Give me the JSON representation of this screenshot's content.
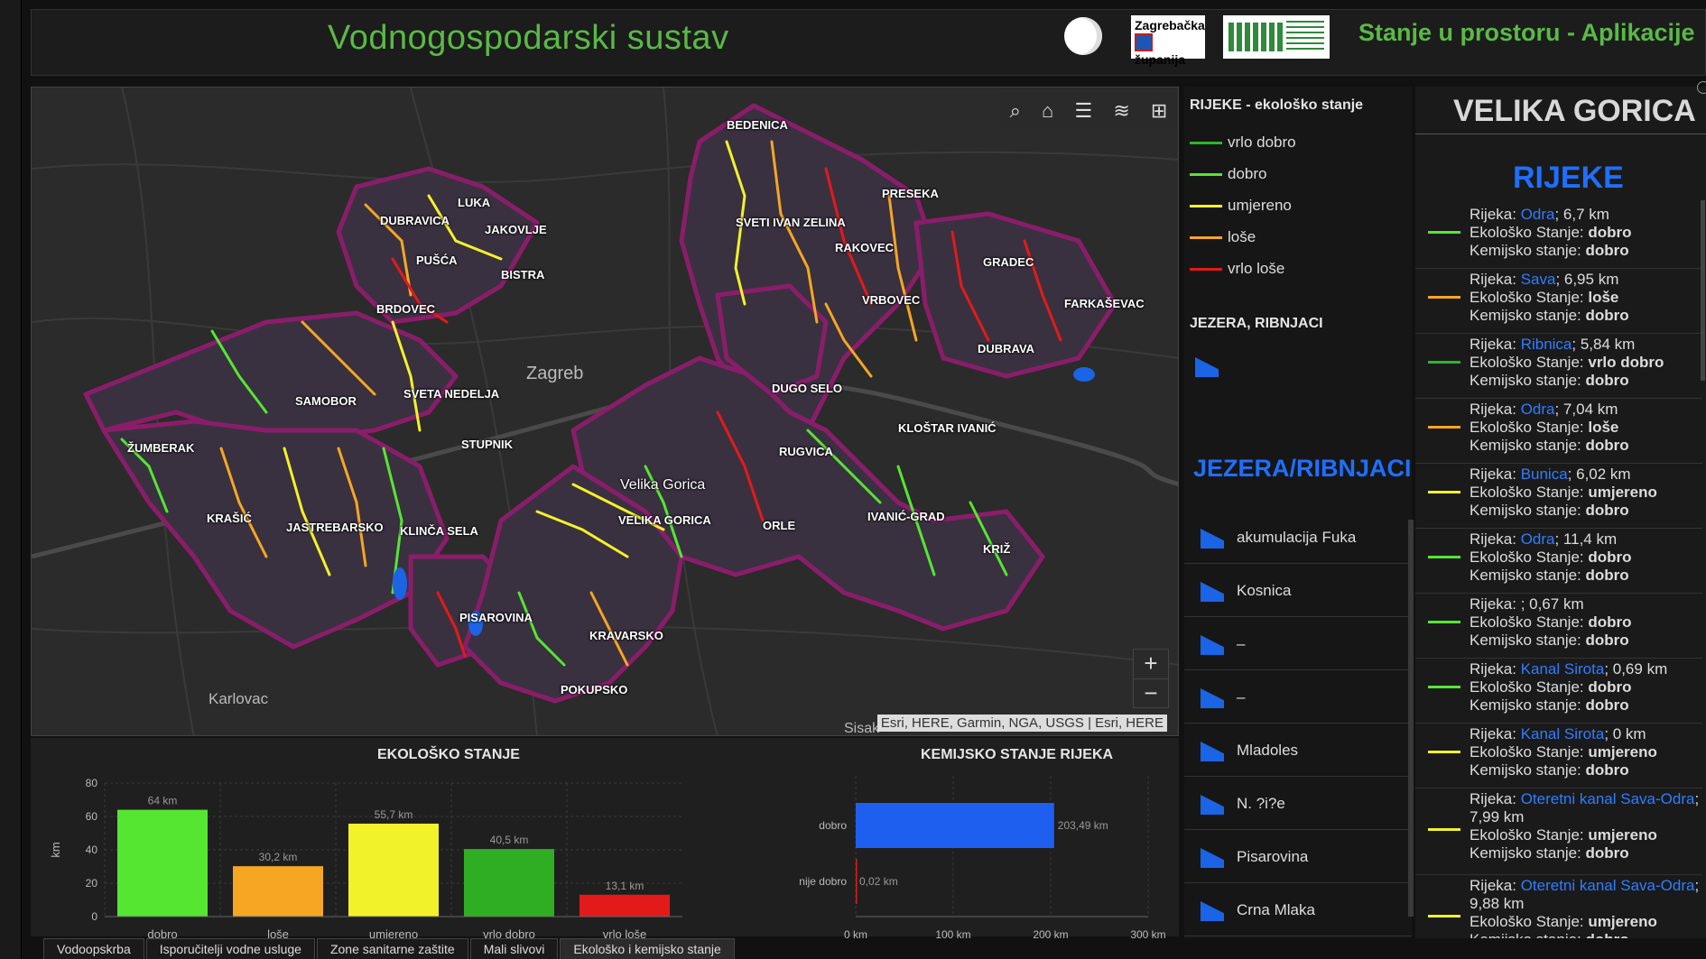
{
  "header": {
    "title": "Vodnogospodarski sustav",
    "app_title": "Stanje u prostoru - Aplikacije",
    "logo1_line1": "Zagrebačka",
    "logo1_line2": "županija"
  },
  "map": {
    "tools": [
      "search-icon",
      "home-icon",
      "list-icon",
      "layers-icon",
      "grid-icon"
    ],
    "city_label": "Zagreb",
    "place_karlovac": "Karlovac",
    "place_sisak": "Sisak",
    "attribution": "Esri, HERE, Garmin, NGA, USGS | Esri, HERE",
    "zoom_in": "+",
    "zoom_out": "−",
    "labels": [
      "BEDENICA",
      "LUKA",
      "DUBRAVICA",
      "JAKOVLJE",
      "PUŠĆA",
      "BISTRA",
      "BRDOVEC",
      "SVETI IVAN ZELINA",
      "PRESEKA",
      "RAKOVEC",
      "GRADEC",
      "VRBOVEC",
      "FARKAŠEVAC",
      "DUBRAVA",
      "SAMOBOR",
      "SVETA NEDELJA",
      "DUGO SELO",
      "KLOŠTAR IVANIĆ",
      "ŽUMBERAK",
      "STUPNIK",
      "RUGVICA",
      "Velika Gorica",
      "VELIKA GORICA",
      "ORLE",
      "IVANIĆ-GRAD",
      "KRAŠIĆ",
      "JASTREBARSKO",
      "KLINČA SELA",
      "KRIŽ",
      "PISAROVINA",
      "KRAVARSKO",
      "POKUPSKO"
    ]
  },
  "legend": {
    "rivers_title": "RIJEKE - ekološko stanje",
    "items": [
      {
        "label": "vrlo dobro",
        "color": "#2db52d"
      },
      {
        "label": "dobro",
        "color": "#55e632"
      },
      {
        "label": "umjereno",
        "color": "#f2f22a"
      },
      {
        "label": "loše",
        "color": "#f5a623"
      },
      {
        "label": "vrlo loše",
        "color": "#e31a1a"
      }
    ],
    "lakes_title": "JEZERA, RIBNJACI"
  },
  "lakes": {
    "title": "JEZERA/RIBNJACI",
    "items": [
      "akumulacija Fuka",
      "Kosnica",
      "–",
      "–",
      "Mladoles",
      "N. ?i?e",
      "Pisarovina",
      "Crna Mlaka"
    ]
  },
  "right": {
    "city": "VELIKA GORICA",
    "title": "RIJEKE",
    "prefix_river": "Rijeka:",
    "prefix_eco": "Ekološko Stanje:",
    "prefix_chem": "Kemijsko stanje:",
    "rivers": [
      {
        "name": "Odra",
        "len": "; 6,7 km",
        "eco": "dobro",
        "chem": "dobro",
        "color": "#55e632"
      },
      {
        "name": "Sava",
        "len": "; 6,95 km",
        "eco": "loše",
        "chem": "dobro",
        "color": "#f5a623"
      },
      {
        "name": "Ribnica",
        "len": "; 5,84 km",
        "eco": "vrlo dobro",
        "chem": "dobro",
        "color": "#2db52d"
      },
      {
        "name": "Odra",
        "len": "; 7,04 km",
        "eco": "loše",
        "chem": "dobro",
        "color": "#f5a623"
      },
      {
        "name": "Bunica",
        "len": "; 6,02 km",
        "eco": "umjereno",
        "chem": "dobro",
        "color": "#f2f22a"
      },
      {
        "name": "Odra",
        "len": "; 11,4 km",
        "eco": "dobro",
        "chem": "dobro",
        "color": "#55e632"
      },
      {
        "name": "",
        "len": "; 0,67 km",
        "eco": "dobro",
        "chem": "dobro",
        "color": "#55e632"
      },
      {
        "name": "Kanal Sirota",
        "len": "; 0,69 km",
        "eco": "dobro",
        "chem": "dobro",
        "color": "#55e632"
      },
      {
        "name": "Kanal Sirota",
        "len": "; 0 km",
        "eco": "umjereno",
        "chem": "dobro",
        "color": "#f2f22a"
      },
      {
        "name": "Oteretni kanal Sava-Odra",
        "len": "; 7,99 km",
        "eco": "umjereno",
        "chem": "dobro",
        "color": "#f2f22a"
      },
      {
        "name": "Oteretni kanal Sava-Odra",
        "len": "; 9,88 km",
        "eco": "umjereno",
        "chem": "dobro",
        "color": "#f2f22a"
      }
    ]
  },
  "chart_data": [
    {
      "type": "bar",
      "title": "EKOLOŠKO STANJE",
      "ylabel": "km",
      "ylim": [
        0,
        80
      ],
      "yticks": [
        0,
        20,
        40,
        60,
        80
      ],
      "categories": [
        "dobro",
        "loše",
        "umjereno",
        "vrlo dobro",
        "vrlo loše"
      ],
      "values": [
        64,
        30.2,
        55.7,
        40.5,
        13.1
      ],
      "data_labels": [
        "64 km",
        "30,2 km",
        "55,7 km",
        "40,5 km",
        "13,1 km"
      ],
      "colors": [
        "#55e632",
        "#f5a623",
        "#f2f22a",
        "#2fae23",
        "#e31a1a"
      ]
    },
    {
      "type": "bar",
      "orientation": "horizontal",
      "title": "KEMIJSKO STANJE RIJEKA",
      "categories": [
        "dobro",
        "nije dobro"
      ],
      "values": [
        203.49,
        0.02
      ],
      "data_labels": [
        "203,49 km",
        "0,02 km"
      ],
      "xlim": [
        0,
        300
      ],
      "xticks": [
        "0 km",
        "100 km",
        "200 km",
        "300 km"
      ],
      "colors": [
        "#1f5ff0",
        "#e31a1a"
      ]
    }
  ],
  "tabs": [
    "Vodoopskrba",
    "Isporučitelji vodne usluge",
    "Zone sanitarne zaštite",
    "Mali slivovi",
    "Ekološko i kemijsko stanje"
  ]
}
